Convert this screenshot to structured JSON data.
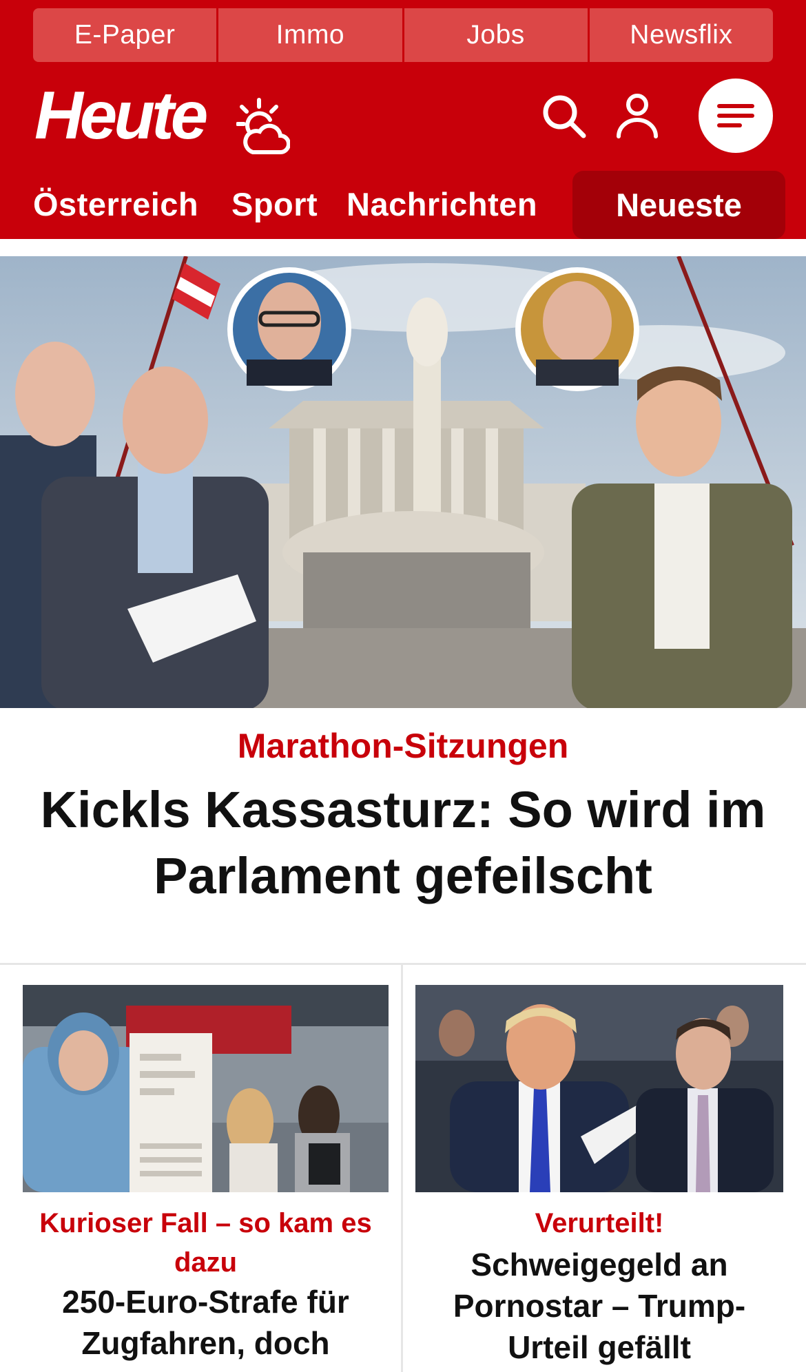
{
  "top_links": [
    "E-Paper",
    "Immo",
    "Jobs",
    "Newsflix"
  ],
  "brand": {
    "logo_text": "Heute"
  },
  "icons": {
    "weather": "weather-sun-cloud-icon",
    "search": "search-icon",
    "account": "user-icon",
    "menu": "hamburger-menu-icon"
  },
  "nav": {
    "items": [
      "Österreich",
      "Sport",
      "Nachrichten"
    ],
    "highlight": "Neueste"
  },
  "hero": {
    "kicker": "Marathon-Sitzungen",
    "title": "Kickls Kassasturz: So wird im Parlament gefeilscht"
  },
  "teasers": [
    {
      "kicker": "Kurioser Fall – so kam es dazu",
      "title": "250-Euro-Strafe für Zugfahren, doch"
    },
    {
      "kicker": "Verurteilt!",
      "title": "Schweigegeld an Pornostar – Trump-Urteil gefällt"
    }
  ],
  "colors": {
    "brand_red": "#c8000a",
    "nav_active": "#a30008",
    "top_link_bg": "#dc4747"
  }
}
